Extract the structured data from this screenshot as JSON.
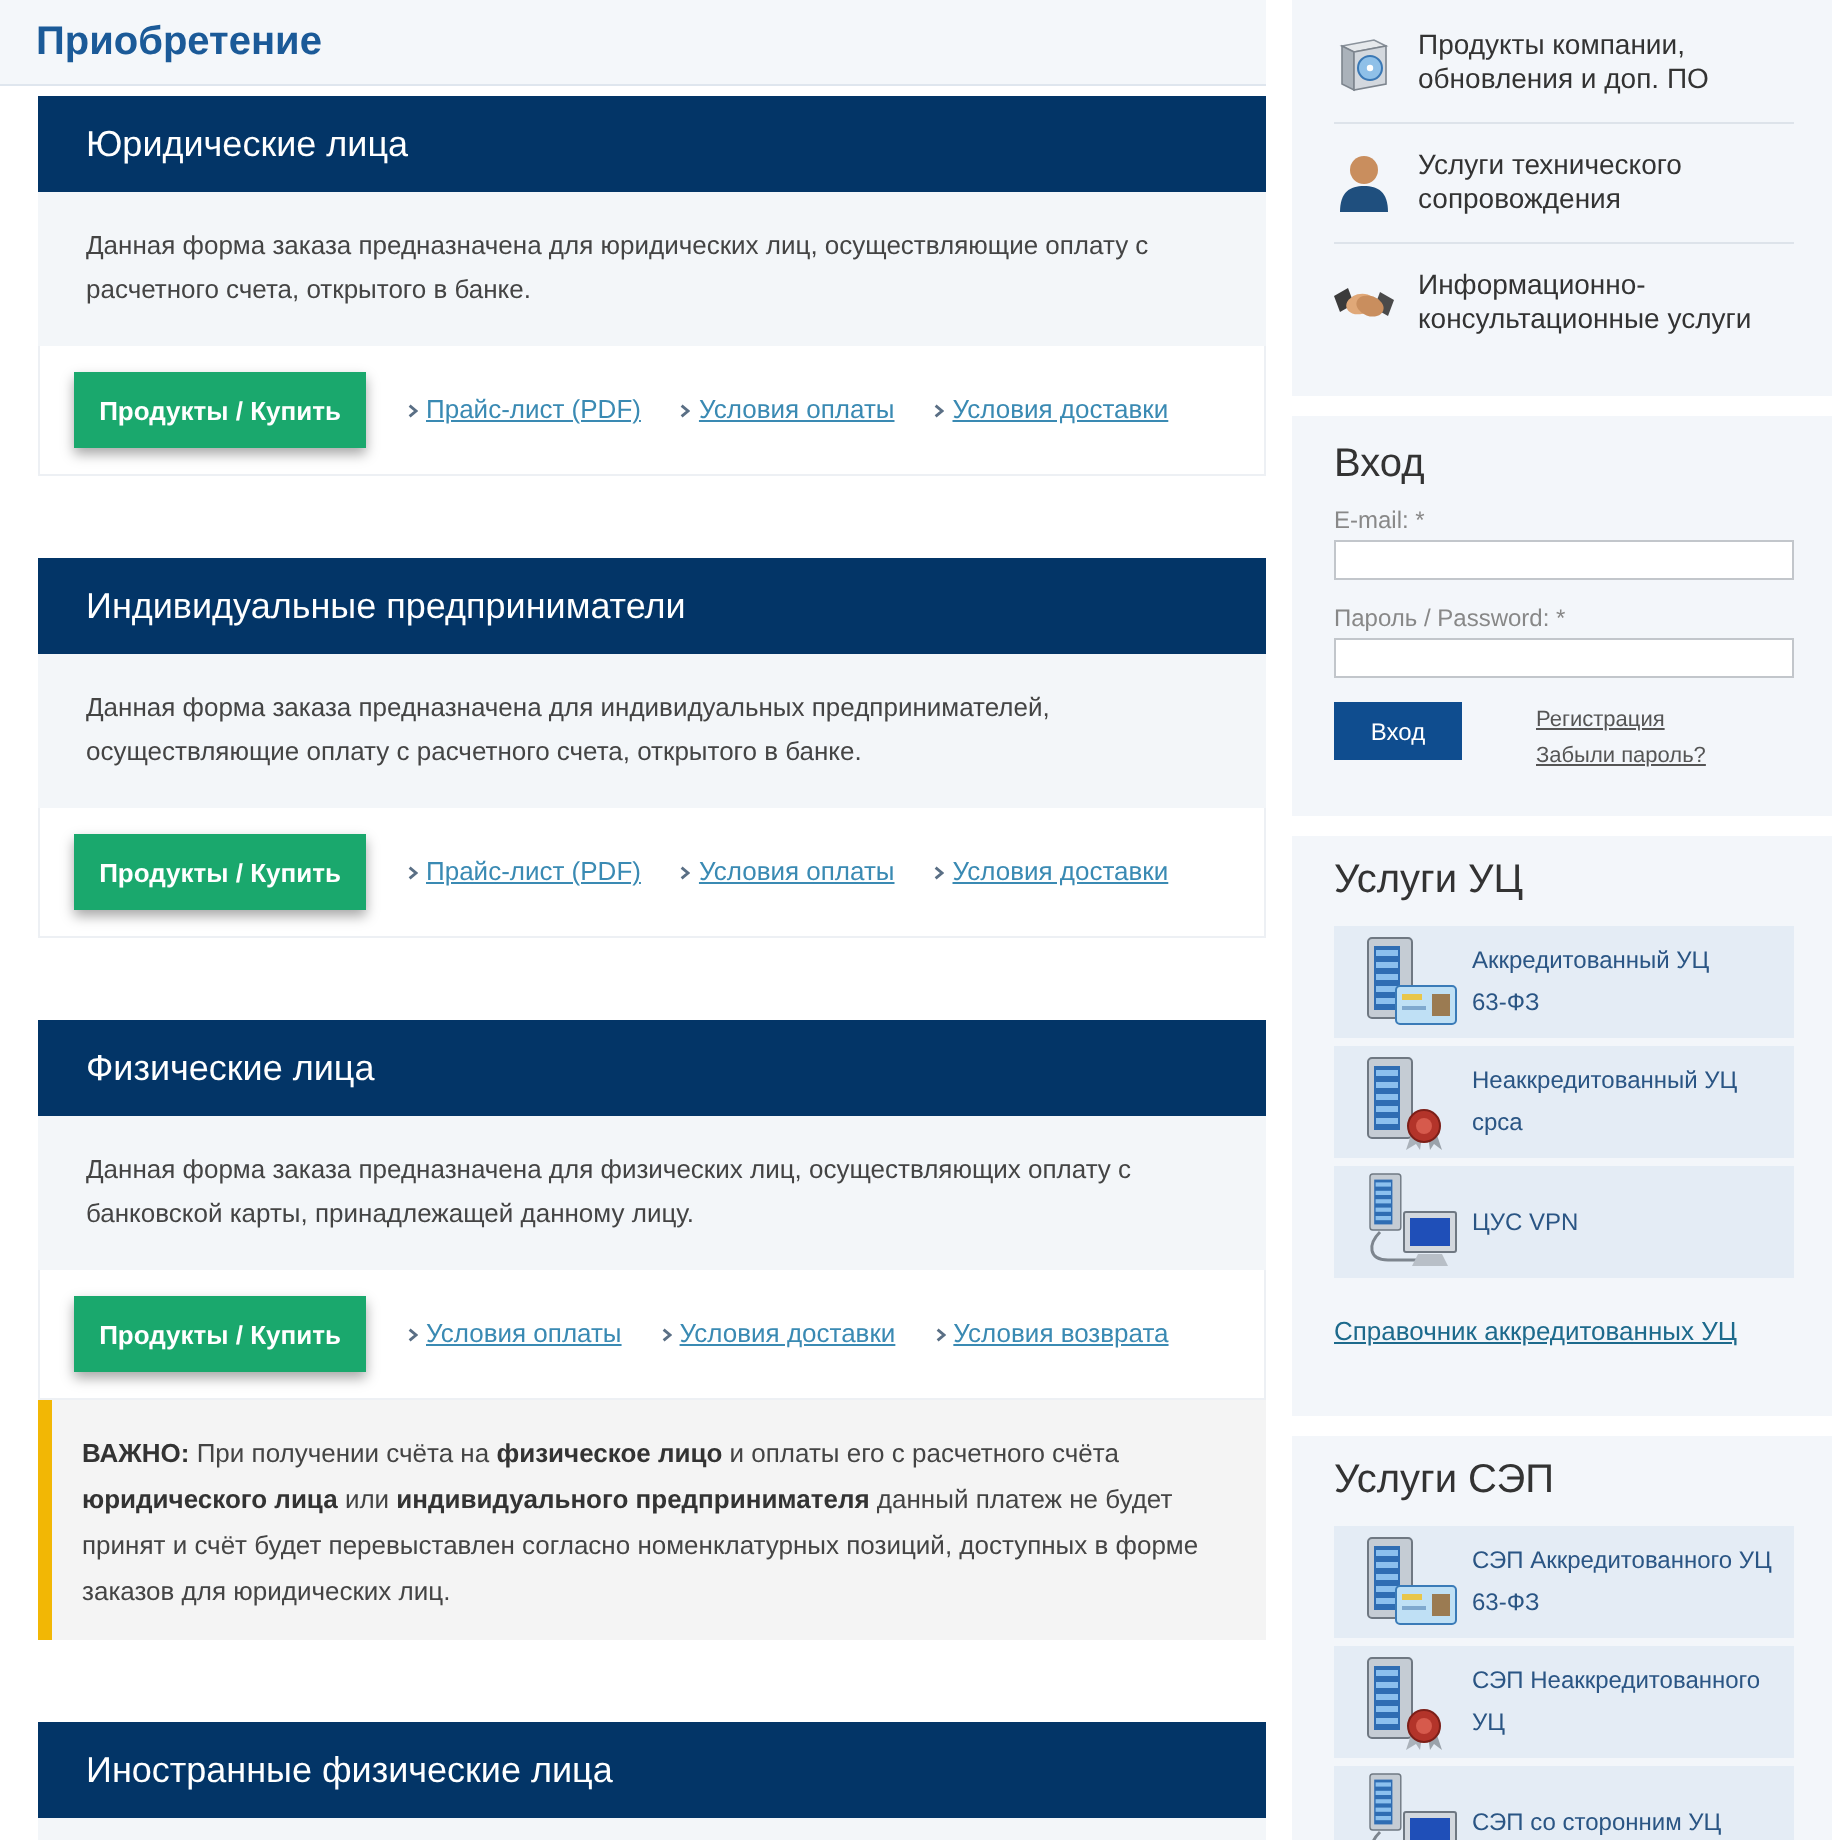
{
  "header": {
    "title": "Приобретение"
  },
  "sections": [
    {
      "title": "Юридические лица",
      "description": "Данная форма заказа предназначена для юридических лиц, осуществляющие оплату с расчетного счета, открытого в банке.",
      "buy_button": "Продукты / Купить",
      "links": [
        "Прайс-лист (PDF)",
        "Условия оплаты",
        "Условия доставки"
      ]
    },
    {
      "title": "Индивидуальные предприниматели",
      "description": "Данная форма заказа предназначена для индивидуальных предпринимателей, осуществляющие оплату с расчетного счета, открытого в банке.",
      "buy_button": "Продукты / Купить",
      "links": [
        "Прайс-лист (PDF)",
        "Условия оплаты",
        "Условия доставки"
      ]
    },
    {
      "title": "Физические лица",
      "description": "Данная форма заказа предназначена для физических лиц, осуществляющих оплату с банковской карты, принадлежащей данному лицу.",
      "buy_button": "Продукты / Купить",
      "links": [
        "Условия оплаты",
        "Условия доставки",
        "Условия возврата"
      ],
      "notice": "**ВАЖНО:** При получении счёта на **физическое лицо** и оплаты его с расчетного счёта **юридического лица** или **индивидуального предпринимателя** данный платеж не будет принят и счёт будет перевыставлен согласно номенклатурных позиций, доступных в форме заказов для юридических лиц."
    },
    {
      "title": "Иностранные физические лица"
    }
  ],
  "sidebar": {
    "services": [
      {
        "kind": "box",
        "label": "Продукты компании, обновления и доп. ПО"
      },
      {
        "kind": "support",
        "label": "Услуги технического сопровождения"
      },
      {
        "kind": "handshake",
        "label": "Информационно-консультационные услуги"
      }
    ],
    "login": {
      "title": "Вход",
      "email_label": "E-mail: *",
      "password_label": "Пароль / Password: *",
      "submit": "Вход",
      "links": [
        "Регистрация",
        "Забыли пароль?"
      ]
    },
    "ca_services": {
      "title": "Услуги УЦ",
      "items": [
        {
          "kind": "certificate",
          "label": "Аккредитованный УЦ\n63-ФЗ"
        },
        {
          "kind": "seal",
          "label": "Неаккредитованный УЦ\ncpca"
        },
        {
          "kind": "network",
          "label": "ЦУС VPN"
        }
      ],
      "link": "Справочник аккредитованных УЦ"
    },
    "sep_services": {
      "title": "Услуги СЭП",
      "items": [
        {
          "kind": "certificate",
          "label": "СЭП Аккредитованного УЦ\n63-ФЗ"
        },
        {
          "kind": "seal",
          "label": "СЭП Неаккредитованного\nУЦ"
        },
        {
          "kind": "network",
          "label": "СЭП со сторонним УЦ"
        }
      ]
    }
  }
}
